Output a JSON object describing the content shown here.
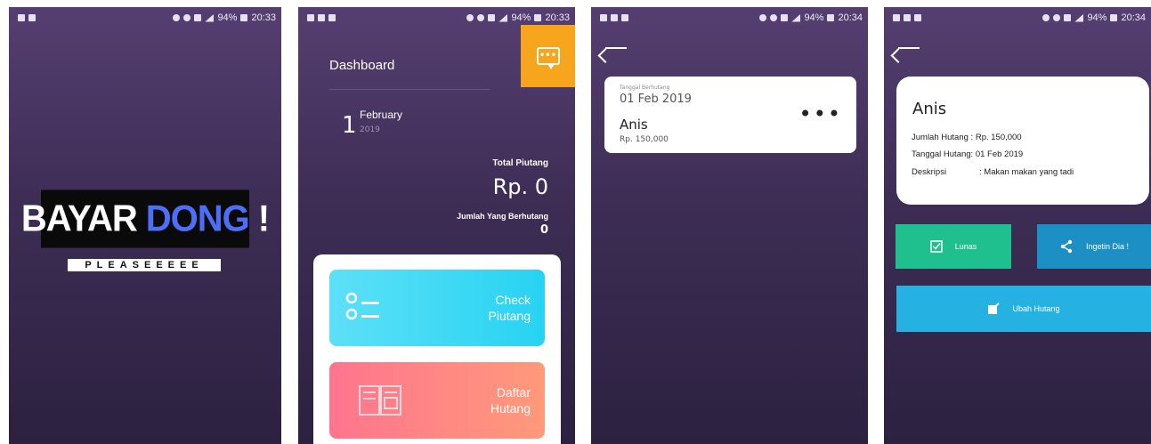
{
  "status_bars": [
    {
      "battery": "94%",
      "time": "20:33"
    },
    {
      "battery": "94%",
      "time": "20:33"
    },
    {
      "battery": "94%",
      "time": "20:34"
    },
    {
      "battery": "94%",
      "time": "20:34"
    }
  ],
  "splash": {
    "logo_word_1": "BAYAR",
    "logo_word_2": "DONG",
    "logo_word_3": "!",
    "tagline": "PLEASEEEEE",
    "colors": {
      "logo_bg": "#0a0a0a",
      "accent": "#4f6ef7"
    }
  },
  "dashboard": {
    "title": "Dashboard",
    "chat_icon": "chat-bubble-icon",
    "date_day": "1",
    "date_month": "February",
    "date_year": "2019",
    "total_label": "Total Piutang",
    "total_value": "Rp. 0",
    "count_label": "Jumlah Yang Berhutang",
    "count_value": "0",
    "cards": [
      {
        "label_line1": "Check",
        "label_line2": "Piutang",
        "icon": "checklist-icon",
        "color": "#27d3f2"
      },
      {
        "label_line1": "Daftar",
        "label_line2": "Hutang",
        "icon": "open-book-icon",
        "color": "#ff748e"
      }
    ],
    "colors": {
      "chat_button": "#f7a51d"
    }
  },
  "list": {
    "item": {
      "caption": "Tanggal Berhutang",
      "date": "01 Feb 2019",
      "name": "Anis",
      "amount": "Rp. 150,000"
    }
  },
  "detail": {
    "name": "Anis",
    "amount_label": "Jumlah Hutang :",
    "amount_value": "Rp. 150,000",
    "date_label": "Tanggal Hutang:",
    "date_value": "01 Feb 2019",
    "desc_label": "Deskripsi",
    "desc_value": ": Makan makan yang tadi",
    "buttons": {
      "lunas": "Lunas",
      "ingetin": "Ingetin Dia !",
      "ubah": "Ubah Hutang"
    },
    "colors": {
      "lunas": "#1fc08d",
      "ingetin": "#1c8fc4",
      "ubah": "#25b2e2"
    }
  }
}
